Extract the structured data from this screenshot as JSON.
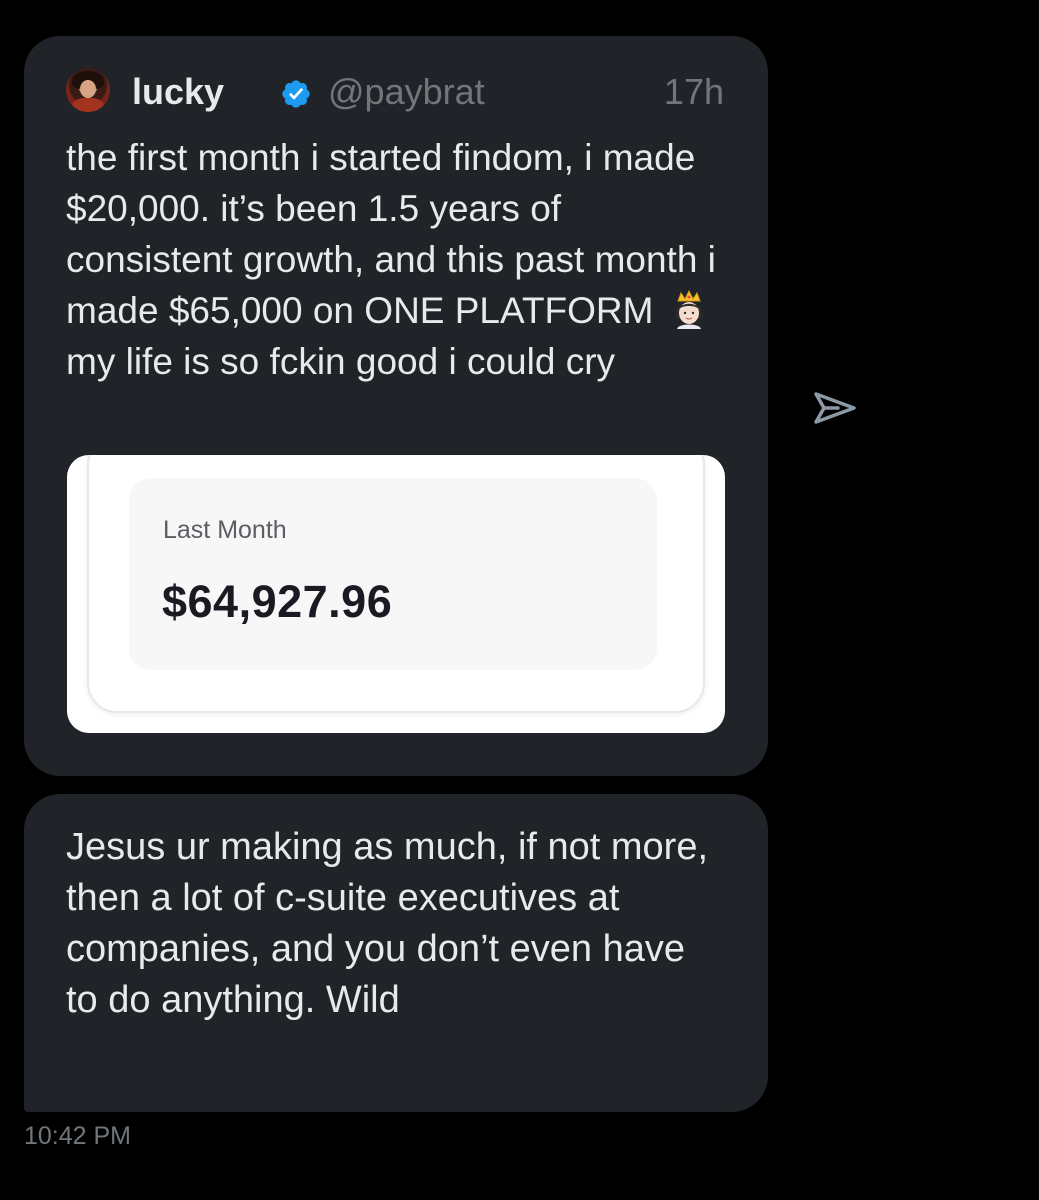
{
  "quoted_tweet": {
    "display_name": "lucky",
    "handle": "@paybrat",
    "time_ago": "17h",
    "text_before_emoji": "the first month i started findom, i made $20,000. it’s been 1.5 years of consistent growth, and this past month i made $65,000 on ONE PLATFORM",
    "emoji": "princess-crown-emoji",
    "text_after_emoji": "my life is so fckin good i could cry",
    "media": {
      "label": "Last Month",
      "value": "$64,927.96"
    }
  },
  "reply_message": {
    "text": "Jesus ur making as much, if not more, then a lot of c-suite executives at companies, and you don’t even have to do anything. Wild"
  },
  "timestamp": "10:42 PM",
  "icons": {
    "share": "send-arrow-icon",
    "verified": "verified-badge-icon"
  },
  "colors": {
    "background": "#000000",
    "bubble": "#202327",
    "verified_blue": "#1d9bf0",
    "muted_text": "#71767b"
  }
}
